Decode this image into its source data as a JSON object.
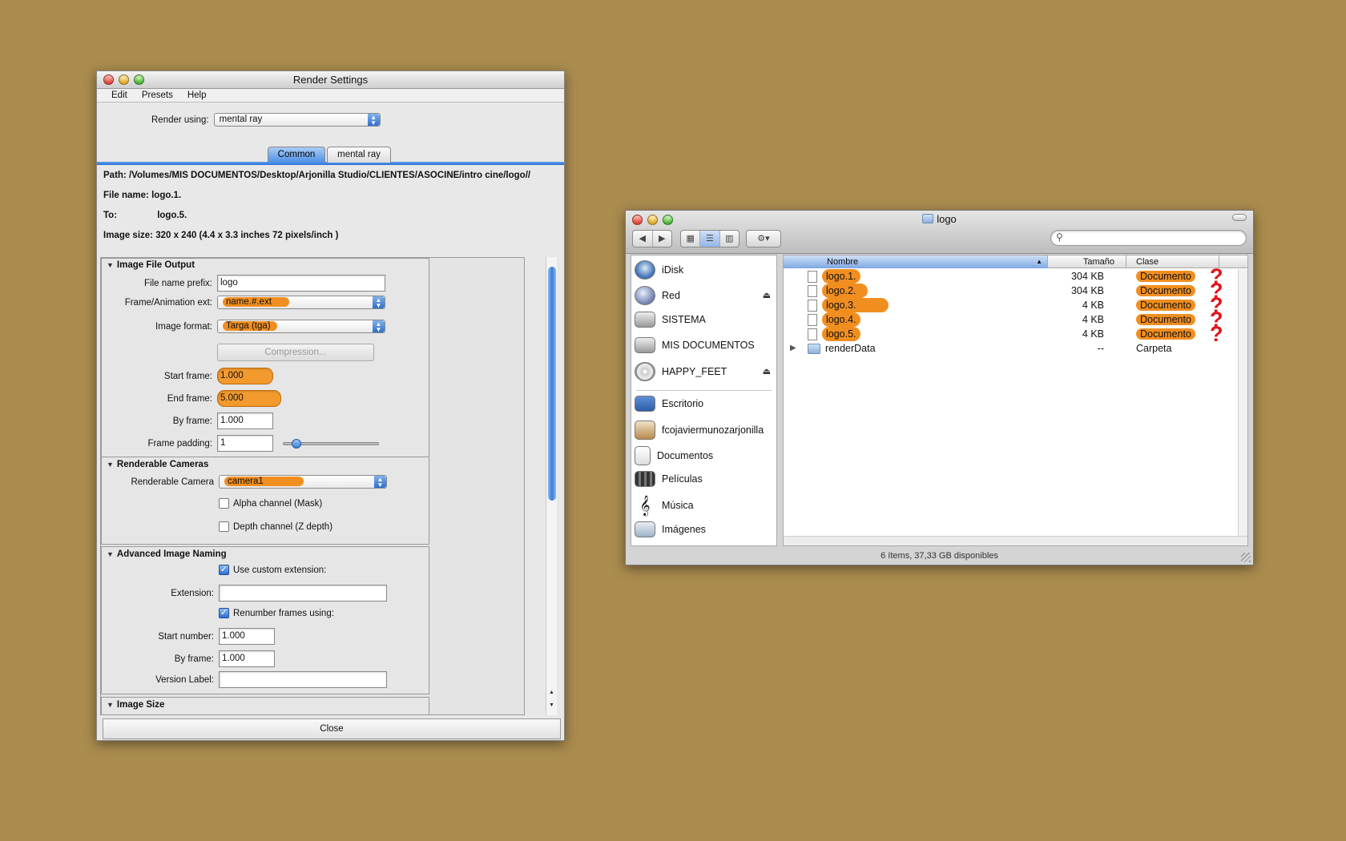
{
  "render_window": {
    "title": "Render Settings",
    "menu": [
      "Edit",
      "Presets",
      "Help"
    ],
    "render_using_label": "Render using:",
    "render_using_value": "mental ray",
    "tabs": [
      "Common",
      "mental ray"
    ],
    "path_label": "Path:",
    "path_value": "/Volumes/MIS DOCUMENTOS/Desktop/Arjonilla Studio/CLIENTES/ASOCINE/intro cine/logo//",
    "file_name_label": "File name:",
    "file_name_value": "logo.1.",
    "to_label": "To:",
    "to_value": "logo.5.",
    "image_size_label": "Image size:",
    "image_size_value": "320 x 240 (4.4 x 3.3 inches 72 pixels/inch )",
    "image_file_output": {
      "header": "Image File Output",
      "prefix_label": "File name prefix:",
      "prefix_value": "logo",
      "ext_label": "Frame/Animation ext:",
      "ext_value": "name.#.ext",
      "format_label": "Image format:",
      "format_value": "Targa (tga)",
      "compression_label": "Compression...",
      "start_label": "Start frame:",
      "start_value": "1.000",
      "end_label": "End frame:",
      "end_value": "5.000",
      "by_label": "By frame:",
      "by_value": "1.000",
      "padding_label": "Frame padding:",
      "padding_value": "1"
    },
    "renderable_cameras": {
      "header": "Renderable Cameras",
      "camera_label": "Renderable Camera",
      "camera_value": "camera1",
      "alpha_label": "Alpha channel (Mask)",
      "depth_label": "Depth channel (Z depth)"
    },
    "advanced_naming": {
      "header": "Advanced Image Naming",
      "custom_ext_label": "Use custom extension:",
      "extension_label": "Extension:",
      "extension_value": "",
      "renumber_label": "Renumber frames using:",
      "start_number_label": "Start number:",
      "start_number_value": "1.000",
      "by_frame_label": "By frame:",
      "by_frame_value": "1.000",
      "version_label": "Version Label:",
      "version_value": ""
    },
    "image_size_header": "Image Size",
    "close_label": "Close"
  },
  "finder_window": {
    "title": "logo",
    "sidebar_devices": [
      {
        "label": "iDisk",
        "icon": "idisk-icon"
      },
      {
        "label": "Red",
        "icon": "network-icon"
      },
      {
        "label": "SISTEMA",
        "icon": "hard-drive-icon"
      },
      {
        "label": "MIS DOCUMENTOS",
        "icon": "hard-drive-icon"
      },
      {
        "label": "HAPPY_FEET",
        "icon": "dvd-icon"
      }
    ],
    "sidebar_places": [
      {
        "label": "Escritorio",
        "icon": "desktop-icon"
      },
      {
        "label": "fcojaviermunozarjonilla",
        "icon": "home-icon"
      },
      {
        "label": "Documentos",
        "icon": "documents-icon"
      },
      {
        "label": "Películas",
        "icon": "movies-icon"
      },
      {
        "label": "Música",
        "icon": "music-icon"
      },
      {
        "label": "Imágenes",
        "icon": "pictures-icon"
      }
    ],
    "columns": [
      "Nombre",
      "Tamaño",
      "Clase"
    ],
    "files": [
      {
        "name": "logo.1.",
        "size": "304 KB",
        "kind": "Documento"
      },
      {
        "name": "logo.2.",
        "size": "304 KB",
        "kind": "Documento"
      },
      {
        "name": "logo.3.",
        "size": "4 KB",
        "kind": "Documento"
      },
      {
        "name": "logo.4.",
        "size": "4 KB",
        "kind": "Documento"
      },
      {
        "name": "logo.5.",
        "size": "4 KB",
        "kind": "Documento"
      },
      {
        "name": "renderData",
        "size": "--",
        "kind": "Carpeta"
      }
    ],
    "question_mark": "?",
    "status": "6 ítems, 37,33 GB disponibles"
  },
  "colors": {
    "desktop": "#ab8c4f",
    "highlight": "#f18e20",
    "question": "#e0141c",
    "selection_blue": "#4f90e6"
  }
}
